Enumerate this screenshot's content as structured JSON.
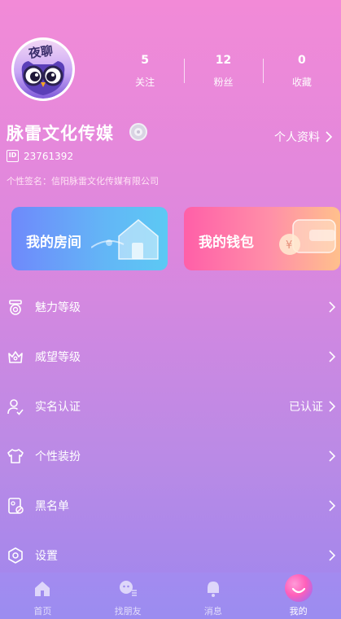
{
  "header": {
    "avatar_text": "夜聊",
    "stats": [
      {
        "value": "5",
        "label": "关注"
      },
      {
        "value": "12",
        "label": "粉丝"
      },
      {
        "value": "0",
        "label": "收藏"
      }
    ]
  },
  "profile": {
    "name": "脉雷文化传媒",
    "profile_link": "个人资料",
    "id_badge": "ID",
    "id": "23761392",
    "signature": "个性签名：信阳脉雷文化传媒有限公司"
  },
  "cards": [
    {
      "title": "我的房间",
      "icon": "house-icon"
    },
    {
      "title": "我的钱包",
      "icon": "wallet-icon"
    }
  ],
  "menu": [
    {
      "label": "魅力等级",
      "icon": "medal-icon",
      "right": ""
    },
    {
      "label": "威望等级",
      "icon": "crown-icon",
      "right": ""
    },
    {
      "label": "实名认证",
      "icon": "user-check-icon",
      "right": "已认证"
    },
    {
      "label": "个性装扮",
      "icon": "shirt-icon",
      "right": ""
    },
    {
      "label": "黑名单",
      "icon": "block-list-icon",
      "right": ""
    },
    {
      "label": "设置",
      "icon": "settings-icon",
      "right": ""
    }
  ],
  "tabs": [
    {
      "label": "首页",
      "icon": "home-icon"
    },
    {
      "label": "找朋友",
      "icon": "find-friends-icon"
    },
    {
      "label": "消息",
      "icon": "bell-icon"
    },
    {
      "label": "我的",
      "icon": "profile-icon",
      "active": true
    }
  ],
  "colors": {
    "room_card_start": "#6f89fb",
    "room_card_end": "#5cc9f4",
    "wallet_card_start": "#ff5fa8",
    "wallet_card_end": "#ffc08c"
  }
}
